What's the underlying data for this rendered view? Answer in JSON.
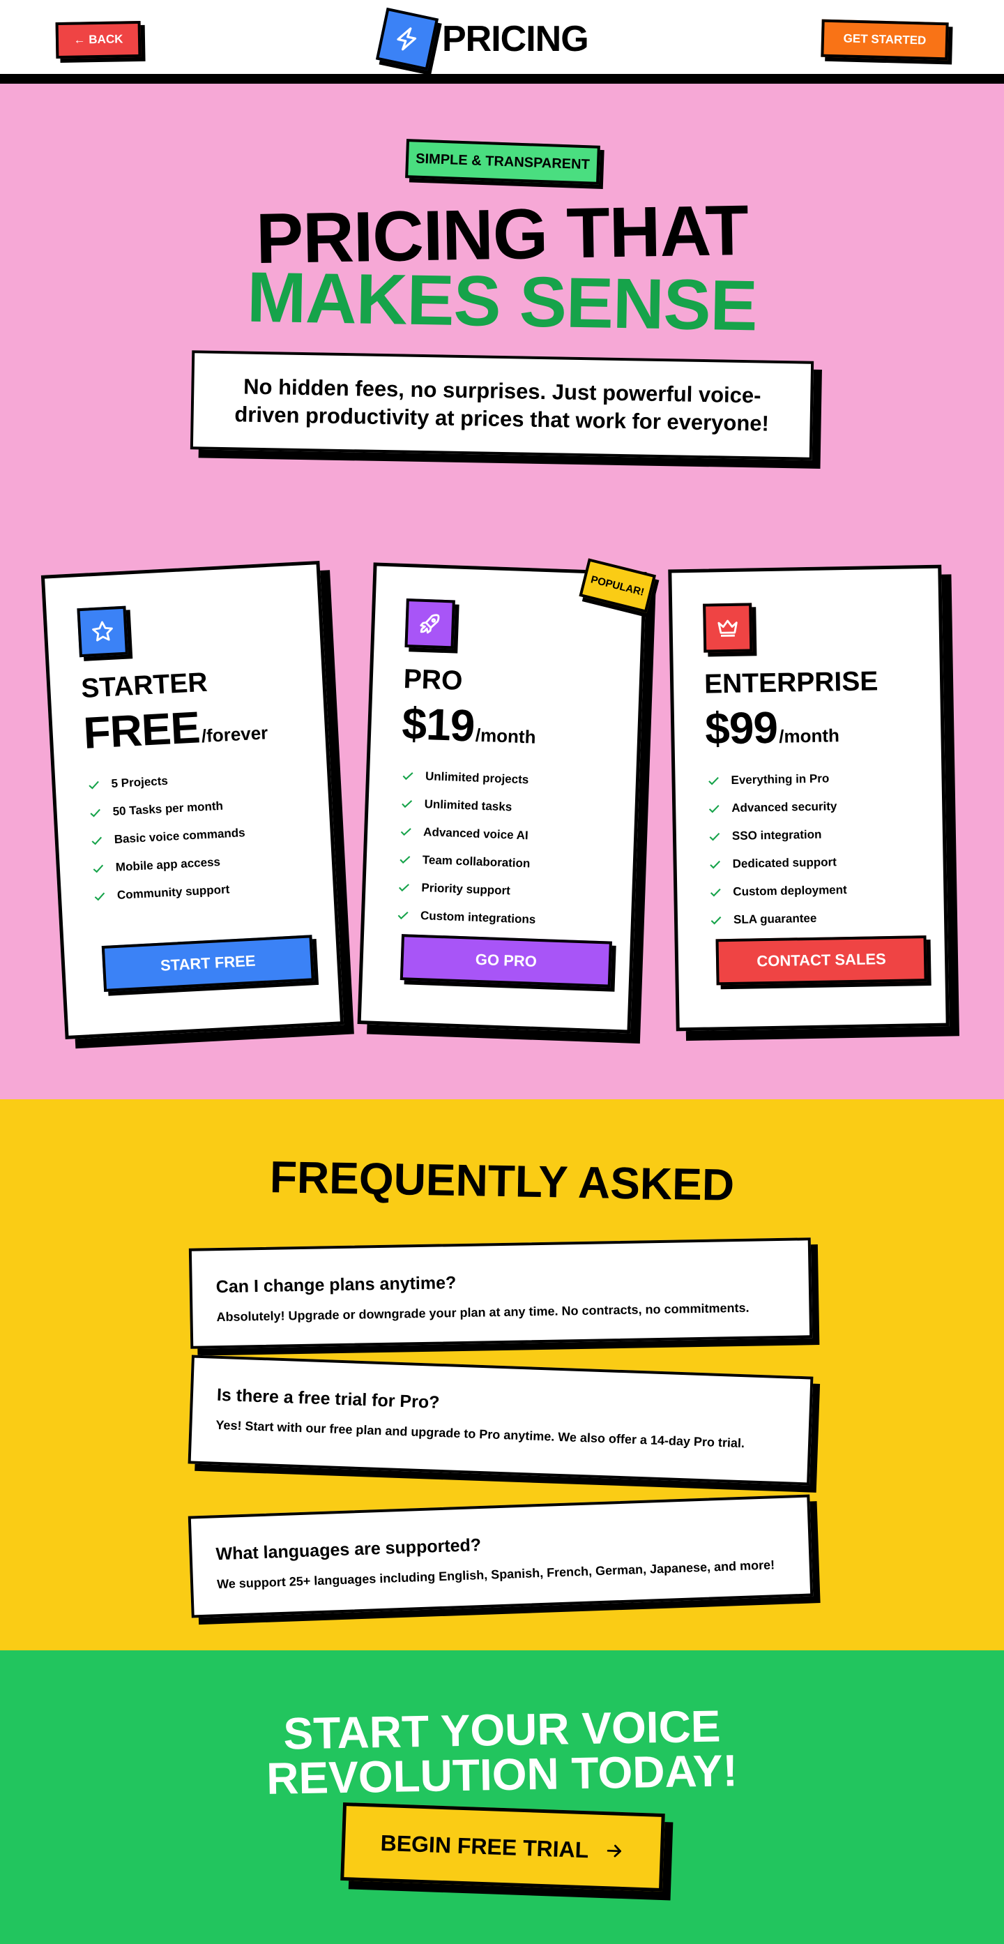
{
  "header": {
    "back_label": "← BACK",
    "brand_title": "PRICING",
    "brand_icon": "lightning-icon",
    "get_started_label": "GET STARTED"
  },
  "hero": {
    "badge": "SIMPLE & TRANSPARENT",
    "title_line1": "PRICING THAT",
    "title_line2": "MAKES SENSE",
    "subtitle": "No hidden fees, no surprises. Just powerful voice-driven productivity at prices that work for everyone!"
  },
  "plans": [
    {
      "name": "STARTER",
      "price": "FREE",
      "period": "/forever",
      "icon": "star-icon",
      "icon_color": "#3b82f6",
      "features": [
        "5 Projects",
        "50 Tasks per month",
        "Basic voice commands",
        "Mobile app access",
        "Community support"
      ],
      "button_label": "START FREE",
      "button_color": "#3b82f6"
    },
    {
      "name": "PRO",
      "price": "$19",
      "period": "/month",
      "icon": "rocket-icon",
      "icon_color": "#a855f7",
      "badge": "POPULAR!",
      "features": [
        "Unlimited projects",
        "Unlimited tasks",
        "Advanced voice AI",
        "Team collaboration",
        "Priority support",
        "Custom integrations"
      ],
      "button_label": "GO PRO",
      "button_color": "#a855f7"
    },
    {
      "name": "ENTERPRISE",
      "price": "$99",
      "period": "/month",
      "icon": "crown-icon",
      "icon_color": "#ef4444",
      "features": [
        "Everything in Pro",
        "Advanced security",
        "SSO integration",
        "Dedicated support",
        "Custom deployment",
        "SLA guarantee"
      ],
      "button_label": "CONTACT SALES",
      "button_color": "#ef4444"
    }
  ],
  "faq": {
    "title": "FREQUENTLY ASKED",
    "items": [
      {
        "question": "Can I change plans anytime?",
        "answer": "Absolutely! Upgrade or downgrade your plan at any time. No contracts, no commitments."
      },
      {
        "question": "Is there a free trial for Pro?",
        "answer": "Yes! Start with our free plan and upgrade to Pro anytime. We also offer a 14-day Pro trial."
      },
      {
        "question": "What languages are supported?",
        "answer": "We support 25+ languages including English, Spanish, French, German, Japanese, and more!"
      }
    ]
  },
  "cta": {
    "title_line1": "START YOUR VOICE",
    "title_line2": "REVOLUTION TODAY!",
    "button_label": "BEGIN FREE TRIAL",
    "button_icon": "arrow-right-icon"
  },
  "colors": {
    "hero_bg": "#f6a8d6",
    "faq_bg": "#facc15",
    "cta_bg": "#22c55e",
    "accent_green": "#16a34a",
    "check_color": "#16a34a"
  }
}
